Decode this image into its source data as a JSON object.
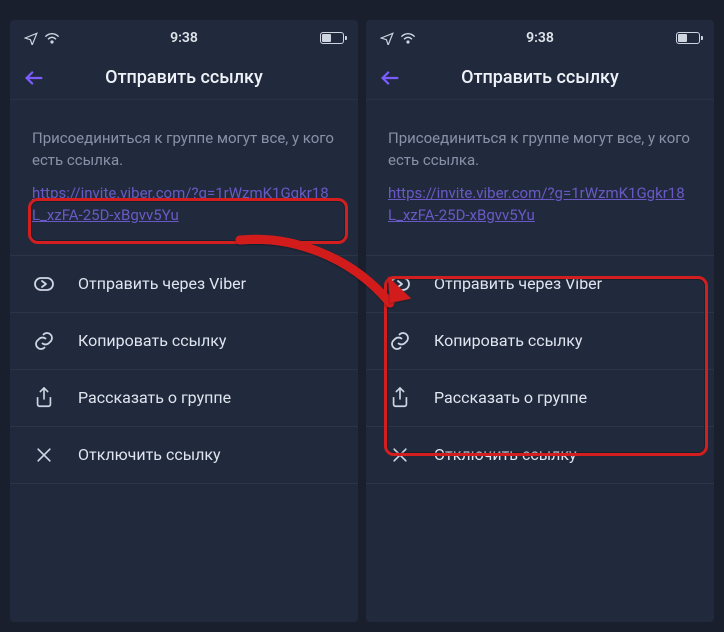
{
  "status": {
    "time": "9:38"
  },
  "header": {
    "title": "Отправить ссылку"
  },
  "description": {
    "text": "Присоединиться к группе могут все, у кого есть ссылка.",
    "link": "https://invite.viber.com/?g=1rWzmK1Ggkr18L_xzFA-25D-xBgvv5Yu"
  },
  "menu": {
    "send_viber": "Отправить через Viber",
    "copy_link": "Копировать ссылку",
    "share_group": "Рассказать о группе",
    "disable_link": "Отключить ссылку"
  }
}
